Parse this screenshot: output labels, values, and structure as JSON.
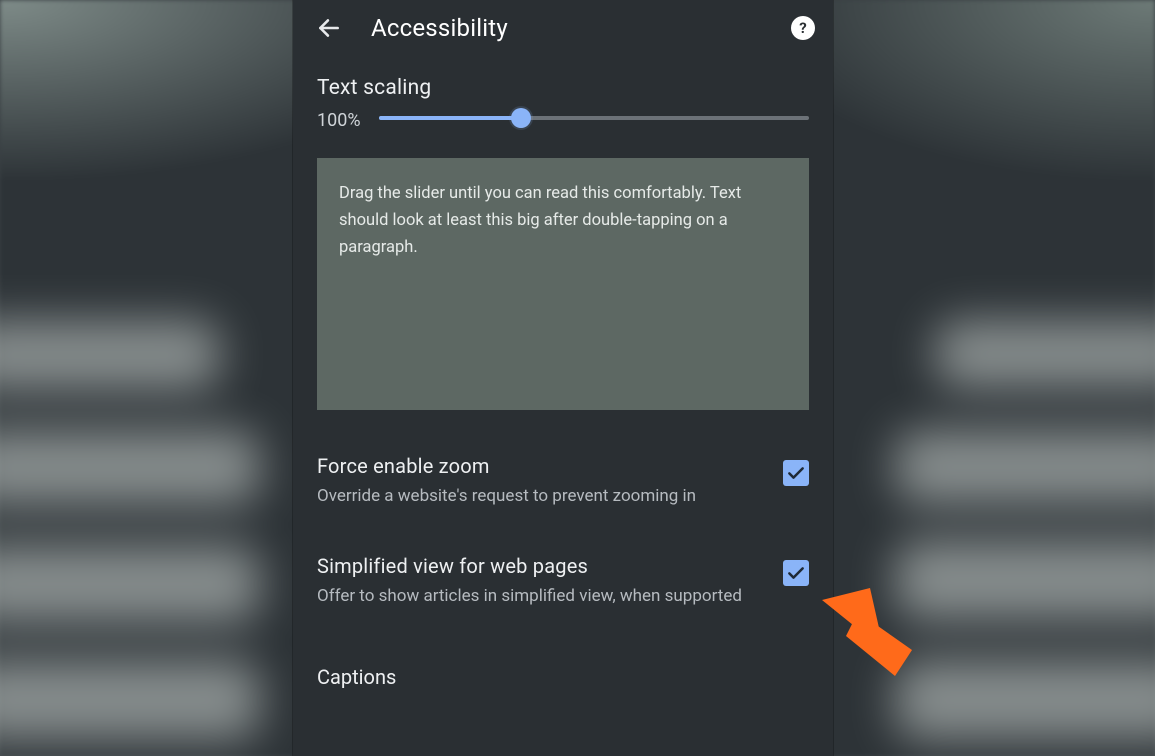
{
  "appbar": {
    "title": "Accessibility",
    "back_icon": "arrow-back",
    "help_icon": "?"
  },
  "text_scaling": {
    "label": "Text scaling",
    "value_text": "100%",
    "value_percent": 33
  },
  "preview_text": "Drag the slider until you can read this comfortably. Text should look at least this big after double-tapping on a paragraph.",
  "settings": {
    "force_zoom": {
      "title": "Force enable zoom",
      "subtitle": "Override a website's request to prevent zooming in",
      "checked": true
    },
    "simplified_view": {
      "title": "Simplified view for web pages",
      "subtitle": "Offer to show articles in simplified view, when supported",
      "checked": true
    }
  },
  "captions": {
    "title": "Captions"
  },
  "colors": {
    "accent": "#8ab4f8",
    "panel": "#2a2f33",
    "preview_bg": "#5d6863",
    "arrow": "#ff6a1a"
  }
}
